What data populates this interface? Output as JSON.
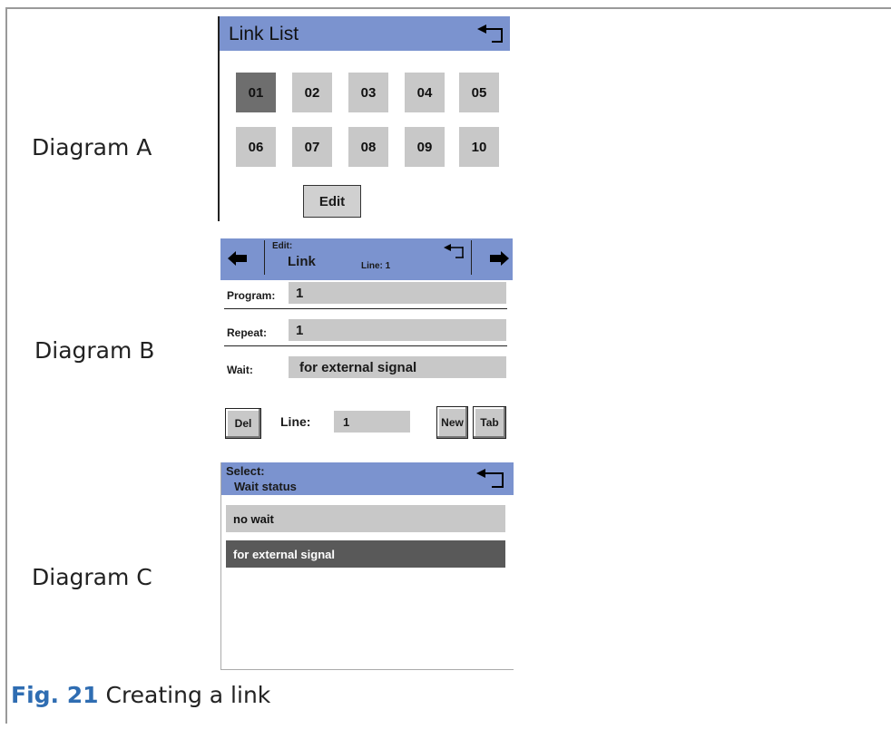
{
  "diagram_labels": [
    "Diagram A",
    "Diagram B",
    "Diagram C"
  ],
  "caption": {
    "fig": "Fig. 21",
    "text": " Creating a link"
  },
  "colors": {
    "header": "#7b93cf",
    "button": "#c8c8c8",
    "selected": "#6e6e6e",
    "accent": "#2f6db2"
  },
  "diagram_a": {
    "title": "Link List",
    "links": [
      "01",
      "02",
      "03",
      "04",
      "05",
      "06",
      "07",
      "08",
      "09",
      "10"
    ],
    "selected_link": "01",
    "edit_label": "Edit"
  },
  "diagram_b": {
    "header_edit": "Edit:",
    "header_title": "Link",
    "header_line": "Line:  1",
    "fields": [
      {
        "label": "Program:",
        "value": "1"
      },
      {
        "label": "Repeat:",
        "value": "1"
      },
      {
        "label": "Wait:",
        "value": "for external signal"
      }
    ],
    "del_label": "Del",
    "line_label": "Line:",
    "line_value": "1",
    "new_label": "New",
    "tab_label": "Tab"
  },
  "diagram_c": {
    "header_select": "Select:",
    "header_title": "Wait status",
    "options": [
      "no wait",
      "for external signal"
    ],
    "selected_option": "for external signal"
  }
}
